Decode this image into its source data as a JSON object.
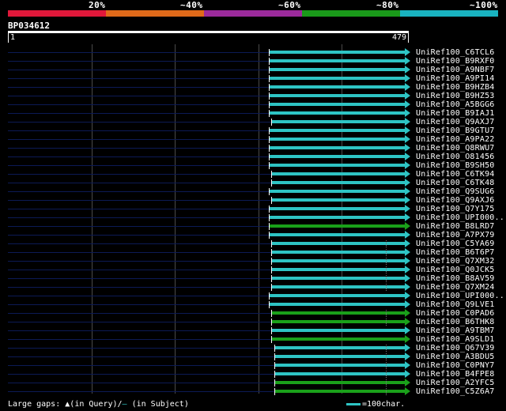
{
  "colors": {
    "bands": [
      "#e0183a",
      "#e06a1a",
      "#9b2a9b",
      "#1a9a1a",
      "#19b3c0"
    ],
    "cyan": "#2ec4c4",
    "green": "#1aa01a"
  },
  "percent_labels": [
    "20%",
    "~40%",
    "~60%",
    "~80%",
    "~100%"
  ],
  "query": {
    "name": "BP034612",
    "start_label": "1",
    "end_label": "479"
  },
  "hits": [
    {
      "name": "UniRef100_C6TCL6",
      "color": "cyan",
      "start": 340,
      "gap": false
    },
    {
      "name": "UniRef100_B9RXF0",
      "color": "cyan",
      "start": 340,
      "gap": false
    },
    {
      "name": "UniRef100_A9NBF7",
      "color": "cyan",
      "start": 340,
      "gap": false
    },
    {
      "name": "UniRef100_A9PI14",
      "color": "cyan",
      "start": 340,
      "gap": false
    },
    {
      "name": "UniRef100_B9HZB4",
      "color": "cyan",
      "start": 340,
      "gap": false
    },
    {
      "name": "UniRef100_B9HZ53",
      "color": "cyan",
      "start": 340,
      "gap": false
    },
    {
      "name": "UniRef100_A5BGG6",
      "color": "cyan",
      "start": 340,
      "gap": false
    },
    {
      "name": "UniRef100_B9IAJ1",
      "color": "cyan",
      "start": 340,
      "gap": false
    },
    {
      "name": "UniRef100_Q9AXJ7",
      "color": "cyan",
      "start": 343,
      "gap": false
    },
    {
      "name": "UniRef100_B9GTU7",
      "color": "cyan",
      "start": 340,
      "gap": false
    },
    {
      "name": "UniRef100_A9PA22",
      "color": "cyan",
      "start": 340,
      "gap": false
    },
    {
      "name": "UniRef100_Q8RWU7",
      "color": "cyan",
      "start": 340,
      "gap": false
    },
    {
      "name": "UniRef100_O81456",
      "color": "cyan",
      "start": 340,
      "gap": false
    },
    {
      "name": "UniRef100_B9SH50",
      "color": "cyan",
      "start": 340,
      "gap": false
    },
    {
      "name": "UniRef100_C6TK94",
      "color": "cyan",
      "start": 343,
      "gap": false
    },
    {
      "name": "UniRef100_C6TK48",
      "color": "cyan",
      "start": 343,
      "gap": false
    },
    {
      "name": "UniRef100_Q9SUG6",
      "color": "cyan",
      "start": 340,
      "gap": false
    },
    {
      "name": "UniRef100_Q9AXJ6",
      "color": "cyan",
      "start": 343,
      "gap": false
    },
    {
      "name": "UniRef100_Q7Y175",
      "color": "cyan",
      "start": 340,
      "gap": false
    },
    {
      "name": "UniRef100_UPI000..",
      "color": "cyan",
      "start": 340,
      "gap": false
    },
    {
      "name": "UniRef100_B8LRD7",
      "color": "green",
      "start": 340,
      "gap": false
    },
    {
      "name": "UniRef100_A7PX79",
      "color": "cyan",
      "start": 340,
      "gap": false
    },
    {
      "name": "UniRef100_C5YA69",
      "color": "cyan",
      "start": 343,
      "gap": true
    },
    {
      "name": "UniRef100_B6T6P7",
      "color": "cyan",
      "start": 343,
      "gap": true
    },
    {
      "name": "UniRef100_Q7XM32",
      "color": "cyan",
      "start": 343,
      "gap": true
    },
    {
      "name": "UniRef100_Q0JCK5",
      "color": "cyan",
      "start": 343,
      "gap": true
    },
    {
      "name": "UniRef100_B8AV59",
      "color": "cyan",
      "start": 343,
      "gap": true
    },
    {
      "name": "UniRef100_Q7XM24",
      "color": "cyan",
      "start": 343,
      "gap": true
    },
    {
      "name": "UniRef100_UPI000..",
      "color": "cyan",
      "start": 340,
      "gap": false
    },
    {
      "name": "UniRef100_Q9LVE1",
      "color": "cyan",
      "start": 340,
      "gap": false
    },
    {
      "name": "UniRef100_C0PAD6",
      "color": "green",
      "start": 343,
      "gap": true
    },
    {
      "name": "UniRef100_B6THK8",
      "color": "green",
      "start": 343,
      "gap": true
    },
    {
      "name": "UniRef100_A9TBM7",
      "color": "cyan",
      "start": 343,
      "gap": false
    },
    {
      "name": "UniRef100_A9SLD1",
      "color": "green",
      "start": 343,
      "gap": false
    },
    {
      "name": "UniRef100_Q67V39",
      "color": "cyan",
      "start": 347,
      "gap": true
    },
    {
      "name": "UniRef100_A3BDU5",
      "color": "cyan",
      "start": 347,
      "gap": true
    },
    {
      "name": "UniRef100_C0PNY7",
      "color": "cyan",
      "start": 347,
      "gap": true
    },
    {
      "name": "UniRef100_B4FPE8",
      "color": "cyan",
      "start": 347,
      "gap": true
    },
    {
      "name": "UniRef100_A2YFC5",
      "color": "green",
      "start": 347,
      "gap": true
    },
    {
      "name": "UniRef100_C5Z6A7",
      "color": "green",
      "start": 347,
      "gap": true
    }
  ],
  "legend": {
    "large_gaps": "Large gaps:",
    "in_query_glyph": "▲",
    "in_query": "(in Query)/",
    "in_subject_glyph": "–",
    "in_subject": "(in Subject)",
    "scale": "=100char."
  }
}
